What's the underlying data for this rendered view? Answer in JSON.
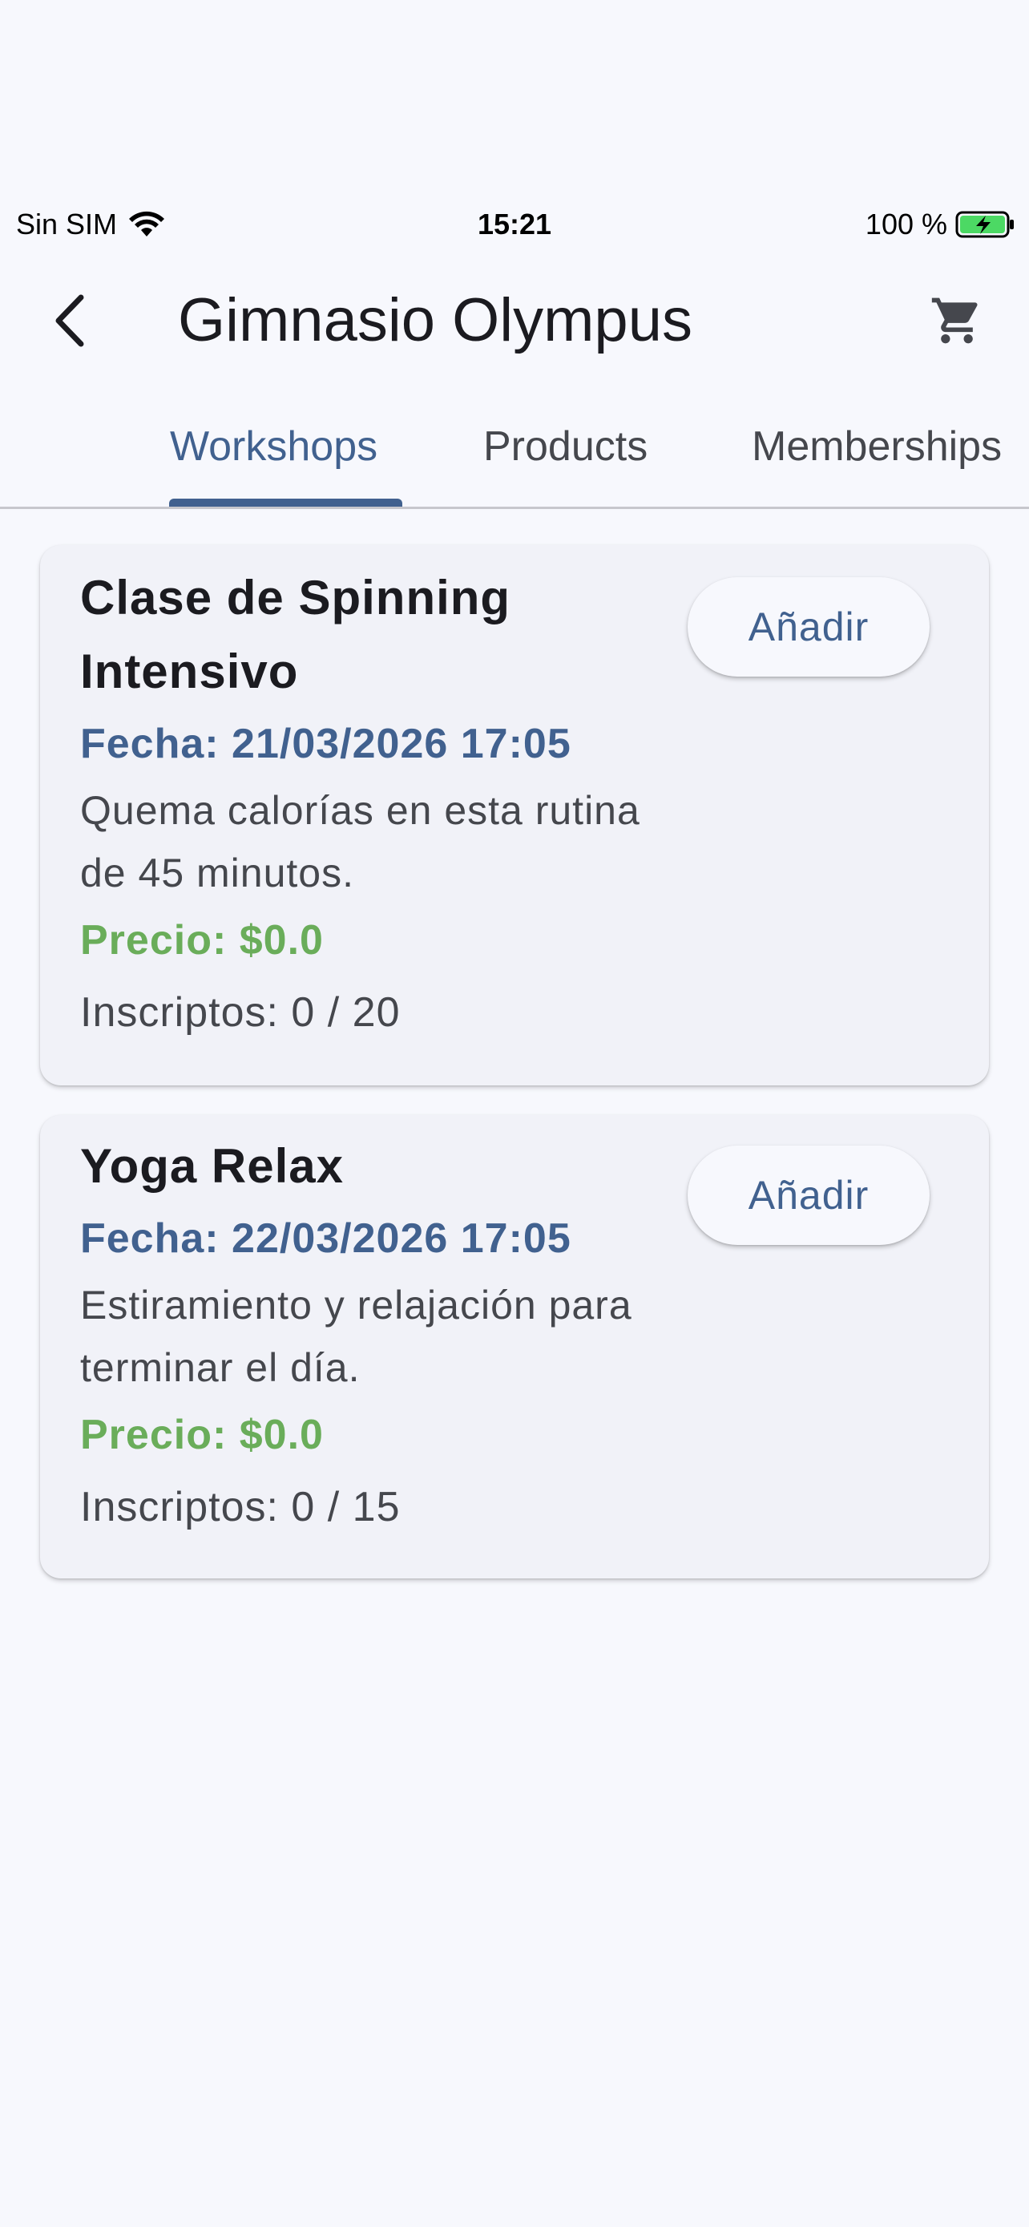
{
  "status_bar": {
    "carrier": "Sin SIM",
    "time": "15:21",
    "battery": "100 %"
  },
  "app_bar": {
    "title": "Gimnasio Olympus"
  },
  "tabs": [
    {
      "label": "Workshops",
      "active": true
    },
    {
      "label": "Products",
      "active": false
    },
    {
      "label": "Memberships",
      "active": false
    }
  ],
  "workshops": [
    {
      "title": "Clase de Spinning Intensivo",
      "date": "Fecha: 21/03/2026 17:05",
      "description": "Quema calorías en esta rutina de 45 minutos.",
      "price": "Precio: $0.0",
      "enrolled": "Inscriptos: 0 / 20",
      "button_label": "Añadir"
    },
    {
      "title": "Yoga Relax",
      "date": "Fecha: 22/03/2026 17:05",
      "description": "Estiramiento y relajación para terminar el día.",
      "price": "Precio: $0.0",
      "enrolled": "Inscriptos: 0 / 15",
      "button_label": "Añadir"
    }
  ],
  "colors": {
    "primary": "#41618f",
    "price": "#6aad5a",
    "background": "#f7f8fd",
    "card": "#f1f2f8"
  },
  "icons": {
    "wifi": "wifi-icon",
    "battery": "battery-charging-icon",
    "back": "chevron-left-icon",
    "cart": "shopping-cart-icon"
  }
}
